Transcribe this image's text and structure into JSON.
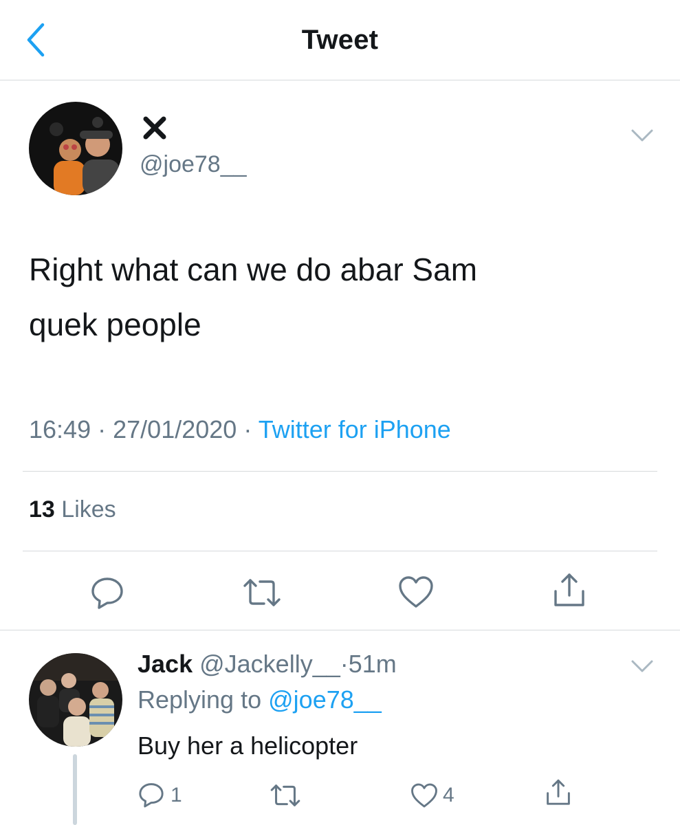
{
  "header": {
    "title": "Tweet",
    "back_icon": "chevron-left-icon"
  },
  "tweet": {
    "display_name": "✖",
    "handle": "@joe78__",
    "text_line1": "Right what can we do abar Sam",
    "text_line2": "quek people",
    "time": "16:49",
    "date": "27/01/2020",
    "separator": "·",
    "source": "Twitter for iPhone",
    "likes_count": "13",
    "likes_label": "Likes",
    "actions": [
      "reply-icon",
      "retweet-icon",
      "like-icon",
      "share-icon"
    ]
  },
  "reply": {
    "name": "Jack",
    "handle": "@Jackelly__",
    "separator": "·",
    "age": "51m",
    "replying_prefix": "Replying to",
    "replying_to": "@joe78__",
    "text": "Buy her a helicopter",
    "reply_count": "1",
    "like_count": "4"
  },
  "colors": {
    "accent": "#1da1f2",
    "secondary_text": "#657786",
    "primary_text": "#14171a",
    "divider": "#d6d9dc"
  }
}
